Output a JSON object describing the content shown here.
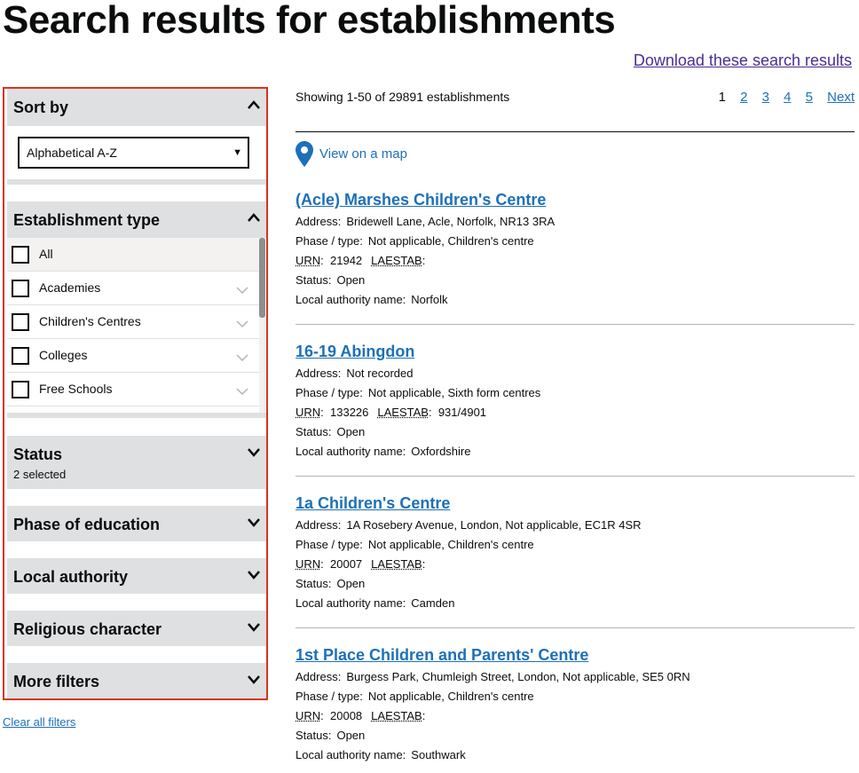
{
  "page": {
    "title": "Search results for establishments",
    "download_link": "Download these search results"
  },
  "filters": {
    "sort_by": {
      "title": "Sort by",
      "selected": "Alphabetical A-Z"
    },
    "establishment_type": {
      "title": "Establishment type",
      "options": [
        "All",
        "Academies",
        "Children's Centres",
        "Colleges",
        "Free Schools"
      ]
    },
    "status": {
      "title": "Status",
      "summary": "2 selected"
    },
    "phase_of_education": {
      "title": "Phase of education"
    },
    "local_authority": {
      "title": "Local authority"
    },
    "religious_character": {
      "title": "Religious character"
    },
    "more_filters": {
      "title": "More filters"
    },
    "clear_all": "Clear all filters"
  },
  "results": {
    "count_text": "Showing 1-50 of 29891 establishments",
    "pagination": {
      "current": "1",
      "pages": [
        "2",
        "3",
        "4",
        "5"
      ],
      "next": "Next"
    },
    "map_link": "View on a map",
    "labels": {
      "address": "Address:",
      "phase_type": "Phase / type:",
      "urn": "URN",
      "laestab": "LAESTAB",
      "status": "Status:",
      "local_authority_name": "Local authority name:"
    },
    "items": [
      {
        "name": "(Acle) Marshes Children's Centre",
        "address": "Bridewell Lane, Acle, Norfolk, NR13 3RA",
        "phase_type": "Not applicable, Children's centre",
        "urn": "21942",
        "laestab": "",
        "status": "Open",
        "local_authority": "Norfolk"
      },
      {
        "name": "16-19 Abingdon",
        "address": "Not recorded",
        "phase_type": "Not applicable, Sixth form centres",
        "urn": "133226",
        "laestab": "931/4901",
        "status": "Open",
        "local_authority": "Oxfordshire"
      },
      {
        "name": "1a Children's Centre",
        "address": "1A Rosebery Avenue, London, Not applicable, EC1R 4SR",
        "phase_type": "Not applicable, Children's centre",
        "urn": "20007",
        "laestab": "",
        "status": "Open",
        "local_authority": "Camden"
      },
      {
        "name": "1st Place Children and Parents' Centre",
        "address": "Burgess Park, Chumleigh Street, London, Not applicable, SE5 0RN",
        "phase_type": "Not applicable, Children's centre",
        "urn": "20008",
        "laestab": "",
        "status": "Open",
        "local_authority": "Southwark"
      }
    ]
  }
}
